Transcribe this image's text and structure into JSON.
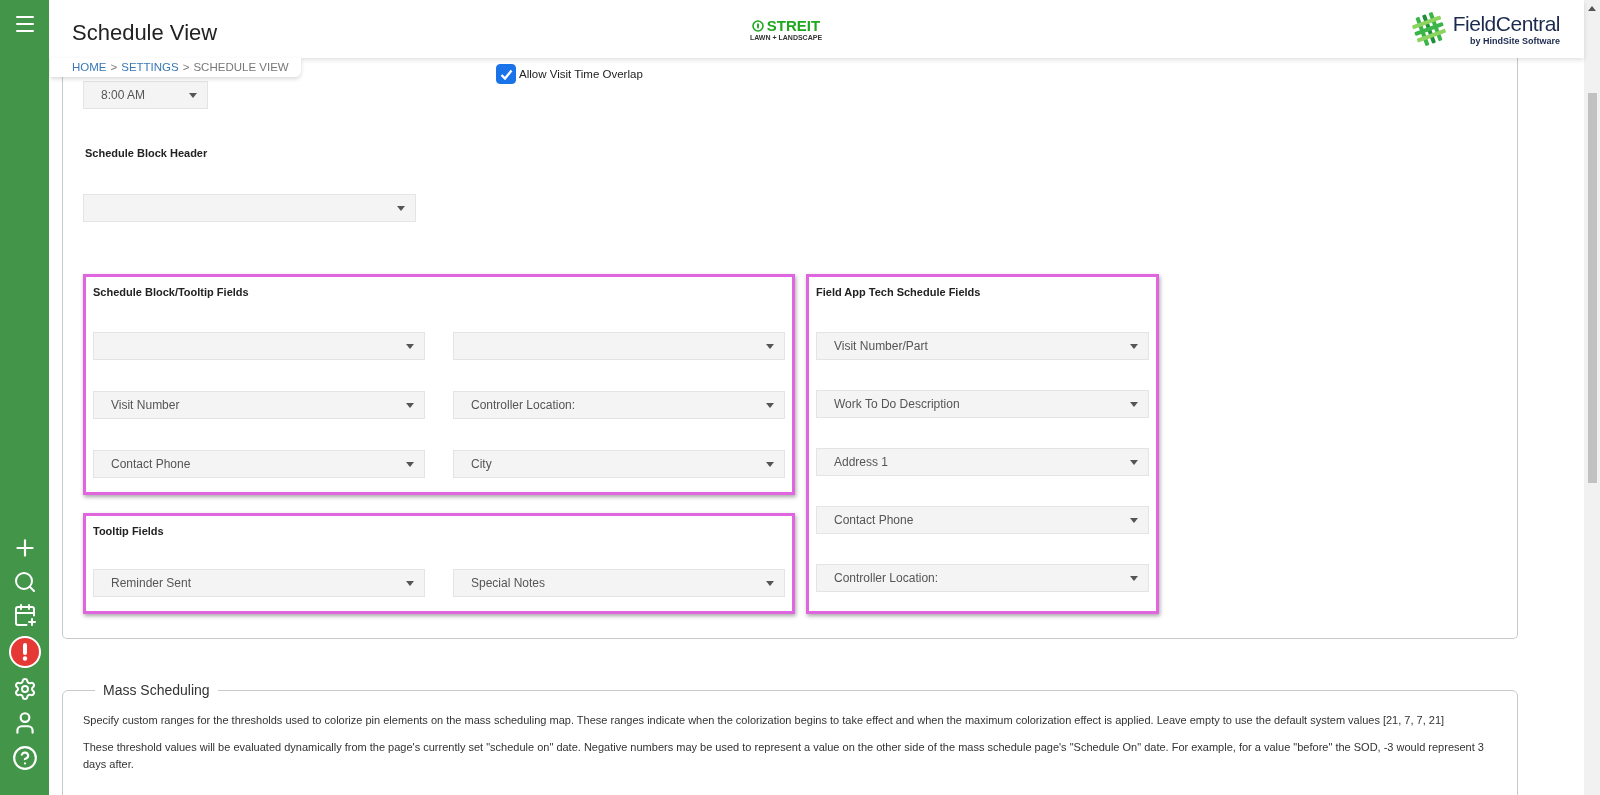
{
  "header": {
    "title": "Schedule View",
    "brand_logo": {
      "name": "STREIT",
      "tagline": "LAWN + LANDSCAPE"
    },
    "vendor_logo": {
      "name": "FieldCentral",
      "tagline": "by HindSite Software"
    }
  },
  "breadcrumb": {
    "separator": ">",
    "items": [
      {
        "label": "HOME",
        "current": false
      },
      {
        "label": "SETTINGS",
        "current": false
      },
      {
        "label": "SCHEDULE VIEW",
        "current": true
      }
    ]
  },
  "start_time": {
    "value": "8:00 AM"
  },
  "allow_overlap": {
    "label": "Allow Visit Time Overlap",
    "checked": true
  },
  "schedule_block_header": {
    "label": "Schedule Block Header"
  },
  "groups": [
    {
      "title": "Schedule Block/Tooltip Fields",
      "kind": "grid",
      "fields": [
        {
          "kind": "blank"
        },
        {
          "kind": "blank"
        },
        {
          "kind": "choice",
          "value": "Visit Number"
        },
        {
          "kind": "choice",
          "value": "Controller Location:"
        },
        {
          "kind": "choice",
          "value": "Contact Phone"
        },
        {
          "kind": "choice",
          "value": "City"
        }
      ]
    },
    {
      "title": "Tooltip Fields",
      "kind": "grid",
      "fields": [
        {
          "kind": "choice",
          "value": "Reminder Sent"
        },
        {
          "kind": "choice",
          "value": "Special Notes"
        }
      ]
    },
    {
      "title": "Field App Tech Schedule Fields",
      "kind": "list",
      "fields": [
        {
          "kind": "choice",
          "value": "Visit Number/Part"
        },
        {
          "kind": "choice",
          "value": "Work To Do Description"
        },
        {
          "kind": "choice",
          "value": "Address 1"
        },
        {
          "kind": "choice",
          "value": "Contact Phone"
        },
        {
          "kind": "choice",
          "value": "Controller Location:"
        }
      ]
    }
  ],
  "mass_scheduling": {
    "legend": "Mass Scheduling",
    "paragraphs": [
      "Specify custom ranges for the thresholds used to colorize pin elements on the mass scheduling map. These ranges indicate when the colorization begins to take effect and when the maximum colorization effect is applied. Leave empty to use the default system values [21, 7, 7, 21]",
      "These threshold values will be evaluated dynamically from the page's currently set \"schedule on\" date. Negative numbers may be used to represent a value on the other side of the mass schedule page's \"Schedule On\" date. For example, for a value \"before\" the SOD, -3 would represent 3 days after."
    ]
  }
}
